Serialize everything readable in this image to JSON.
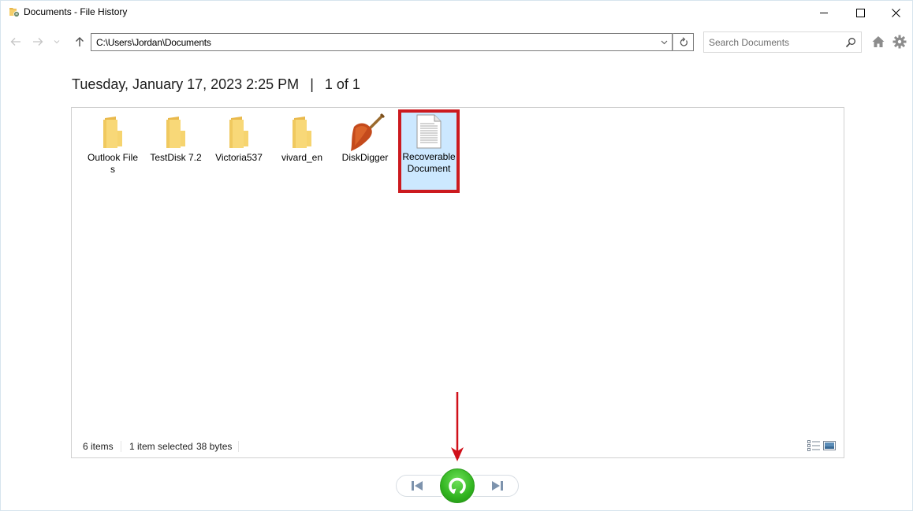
{
  "window": {
    "title": "Documents - File History",
    "controls": {
      "minimize": "minimize",
      "maximize": "maximize",
      "close": "close"
    }
  },
  "nav": {
    "address": "C:\\Users\\Jordan\\Documents",
    "search_placeholder": "Search Documents"
  },
  "header": {
    "date": "Tuesday, January 17, 2023 2:25 PM",
    "separator": "|",
    "page": "1 of 1"
  },
  "items": [
    {
      "label": "Outlook Files",
      "type": "folder",
      "icon": "folder-icon",
      "selected": false
    },
    {
      "label": "TestDisk 7.2",
      "type": "folder",
      "icon": "folder-icon",
      "selected": false
    },
    {
      "label": "Victoria537",
      "type": "folder",
      "icon": "folder-icon",
      "selected": false
    },
    {
      "label": "vivard_en",
      "type": "folder",
      "icon": "folder-icon",
      "selected": false
    },
    {
      "label": "DiskDigger",
      "type": "application",
      "icon": "shovel-icon",
      "selected": false
    },
    {
      "label": "Recoverable Document",
      "type": "document",
      "icon": "text-document-icon",
      "selected": true
    }
  ],
  "status": {
    "item_count": "6 items",
    "selection": "1 item selected",
    "size": "38 bytes"
  },
  "colors": {
    "selection_bg": "#cce8ff",
    "highlight_border": "#cc1a1f",
    "restore_green": "#31b41f",
    "annotation_red": "#d0101a"
  }
}
